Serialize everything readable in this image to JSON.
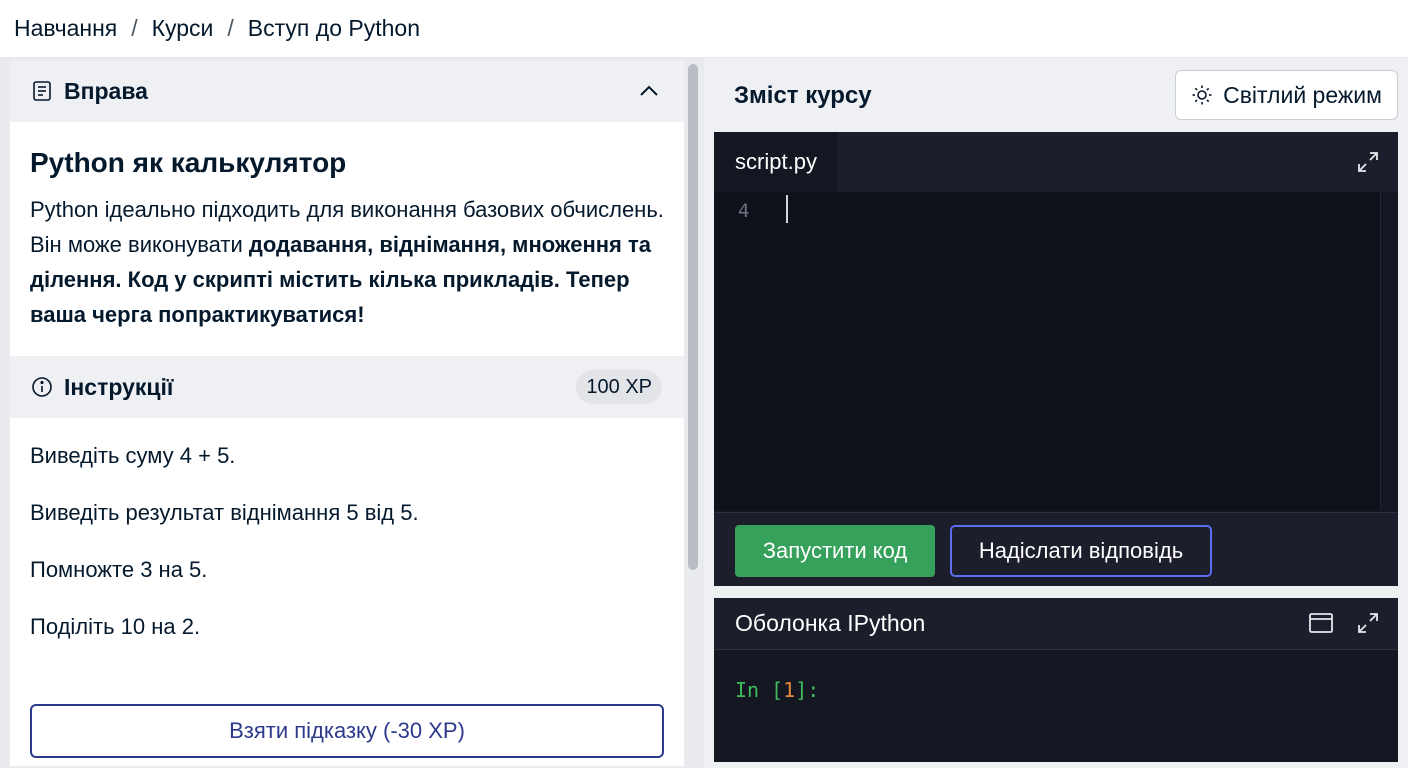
{
  "breadcrumb": {
    "items": [
      "Навчання",
      "Курси",
      "Вступ до Python"
    ],
    "separator": "/"
  },
  "exercise": {
    "header_label": "Вправа",
    "title": "Python як калькулятор",
    "text_plain": "Python ідеально підходить для виконання базових обчислень. Він може виконувати ",
    "text_bold": "додавання, віднімання, множення та ділення. Код у скрипті містить кілька прикладів.  Тепер ваша черга попрактикуватися!"
  },
  "instructions": {
    "header_label": "Інструкції",
    "xp_badge": "100 XP",
    "items": [
      "Виведіть суму 4 + 5.",
      "Виведіть результат віднімання 5 від 5.",
      "Помножте 3 на 5.",
      "Поділіть 10 на 2."
    ],
    "hint_button": "Взяти підказку (-30 XP)"
  },
  "course": {
    "title": "Зміст курсу",
    "light_mode_label": "Світлий режим"
  },
  "editor": {
    "tab_name": "script.py",
    "line_number": "4",
    "run_button": "Запустити код",
    "submit_button": "Надіслати відповідь"
  },
  "shell": {
    "title": "Оболонка IPython",
    "prompt_in": "In ",
    "prompt_open": "[",
    "prompt_num": "1",
    "prompt_close": "]:"
  },
  "colors": {
    "accent_green": "#36a15a",
    "accent_blue": "#5b6cf0",
    "hint_blue": "#2d3a8c",
    "editor_bg": "#0e111a"
  },
  "icons": {
    "exercise": "document-icon",
    "instructions": "info-icon",
    "collapse": "chevron-up-icon",
    "light_mode": "sun-icon",
    "expand": "expand-icon",
    "shell_window": "window-icon"
  }
}
